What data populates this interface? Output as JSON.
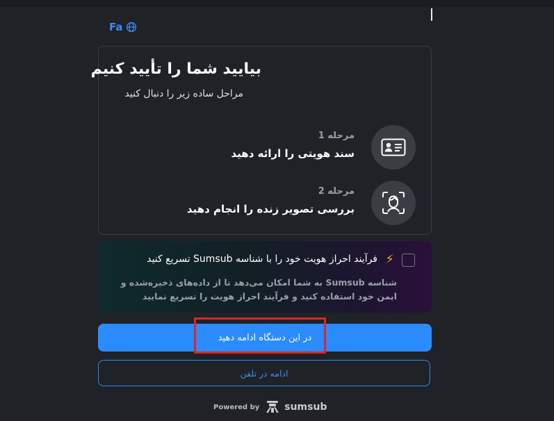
{
  "language": {
    "code": "Fa"
  },
  "card": {
    "title": "بیایید شما را تأیید کنیم",
    "subtitle": "مراحل ساده زیر را دنبال کنید",
    "steps": [
      {
        "number_label": "مرحله 1",
        "text": "سند هویتی را ارائه دهید",
        "icon": "id-card-icon"
      },
      {
        "number_label": "مرحله 2",
        "text": "بررسی تصویر زنده را انجام دهید",
        "icon": "face-scan-icon"
      }
    ]
  },
  "promo": {
    "title": "فرآیند احراز هویت خود را با شناسه Sumsub تسریع کنید",
    "body": "شناسه Sumsub به شما امکان می‌دهد تا از داده‌های ذخیره‌شده و ایمن خود استفاده کنید و فرآیند احراز هویت را تسریع نمایید",
    "icon": "lightning-icon",
    "checked": false
  },
  "buttons": {
    "continue_device": "در این دستگاه ادامه دهید",
    "continue_phone": "ادامه در تلفن"
  },
  "footer": {
    "powered_by": "Powered by",
    "brand": "sumsub"
  },
  "colors": {
    "accent": "#2b8cff",
    "highlight": "#e02424",
    "bolt": "#f5a623",
    "background": "#1f2227"
  }
}
